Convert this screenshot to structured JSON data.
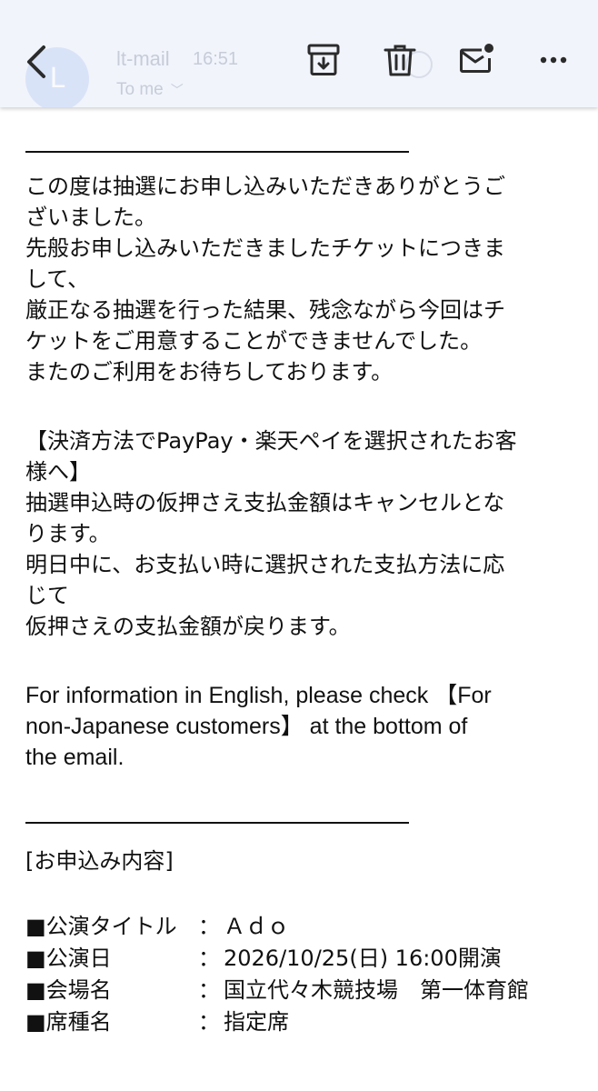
{
  "header": {
    "sender_initial": "L",
    "sender_name": "lt-mail",
    "time": "16:51",
    "recipient": "To me"
  },
  "icons": {
    "back": "chevron-left-icon",
    "archive": "archive-icon",
    "delete": "trash-icon",
    "mark_unread": "mail-unread-icon",
    "more": "more-horizontal-icon"
  },
  "email": {
    "paragraphs": [
      [
        "この度は抽選にお申し込みいただきありがとうご",
        "ざいました。",
        "先般お申し込みいただきましたチケットにつきま",
        "して、",
        "厳正なる抽選を行った結果、残念ながら今回はチ",
        "ケットをご用意することができませんでした。",
        "またのご利用をお待ちしております。"
      ],
      [
        "【決済方法でPayPay・楽天ペイを選択されたお客",
        "様へ】",
        "抽選申込時の仮押さえ支払金額はキャンセルとな",
        "ります。",
        "明日中に、お支払い時に選択された支払方法に応",
        "じて",
        "仮押さえの支払金額が戻ります。"
      ],
      [
        "For information in English, please check 【For",
        "non-Japanese customers】 at the bottom of",
        "the email."
      ]
    ],
    "section_title": "[お申込み内容]",
    "details": [
      {
        "label": "■公演タイトル",
        "sep": "：",
        "value": "Ａｄｏ"
      },
      {
        "label": "■公演日",
        "sep": "：",
        "value": "2026/10/25(日) 16:00開演"
      },
      {
        "label": "■会場名",
        "sep": "：",
        "value": "国立代々木競技場　第一体育館"
      },
      {
        "label": "■席種名",
        "sep": "：",
        "value": "指定席"
      }
    ]
  },
  "colors": {
    "header_bg": "#f1f4fb",
    "icon_color": "#2b2b2b",
    "text": "#111111"
  }
}
